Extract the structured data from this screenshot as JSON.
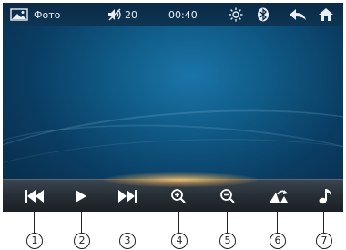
{
  "statusbar": {
    "photo_label": "Фото",
    "volume": "20",
    "time": "00:40",
    "icons": [
      "photo-icon",
      "mute-icon",
      "brightness-icon",
      "bluetooth-icon",
      "back-icon",
      "home-icon"
    ]
  },
  "controls": [
    {
      "name": "previous",
      "icon": "skip-previous-icon"
    },
    {
      "name": "play",
      "icon": "play-icon"
    },
    {
      "name": "next",
      "icon": "skip-next-icon"
    },
    {
      "name": "zoom-in",
      "icon": "zoom-in-icon"
    },
    {
      "name": "zoom-out",
      "icon": "zoom-out-icon"
    },
    {
      "name": "rotate",
      "icon": "rotate-icon"
    },
    {
      "name": "music",
      "icon": "music-note-icon"
    }
  ],
  "callouts": [
    "1",
    "2",
    "3",
    "4",
    "5",
    "6",
    "7"
  ],
  "colors": {
    "screen_bg": "#0f5a86",
    "statusbar_bg": "#0b2a46",
    "controlbar_bg": "#262e35",
    "glow": "#ffcd78",
    "icon": "#ffffff"
  }
}
